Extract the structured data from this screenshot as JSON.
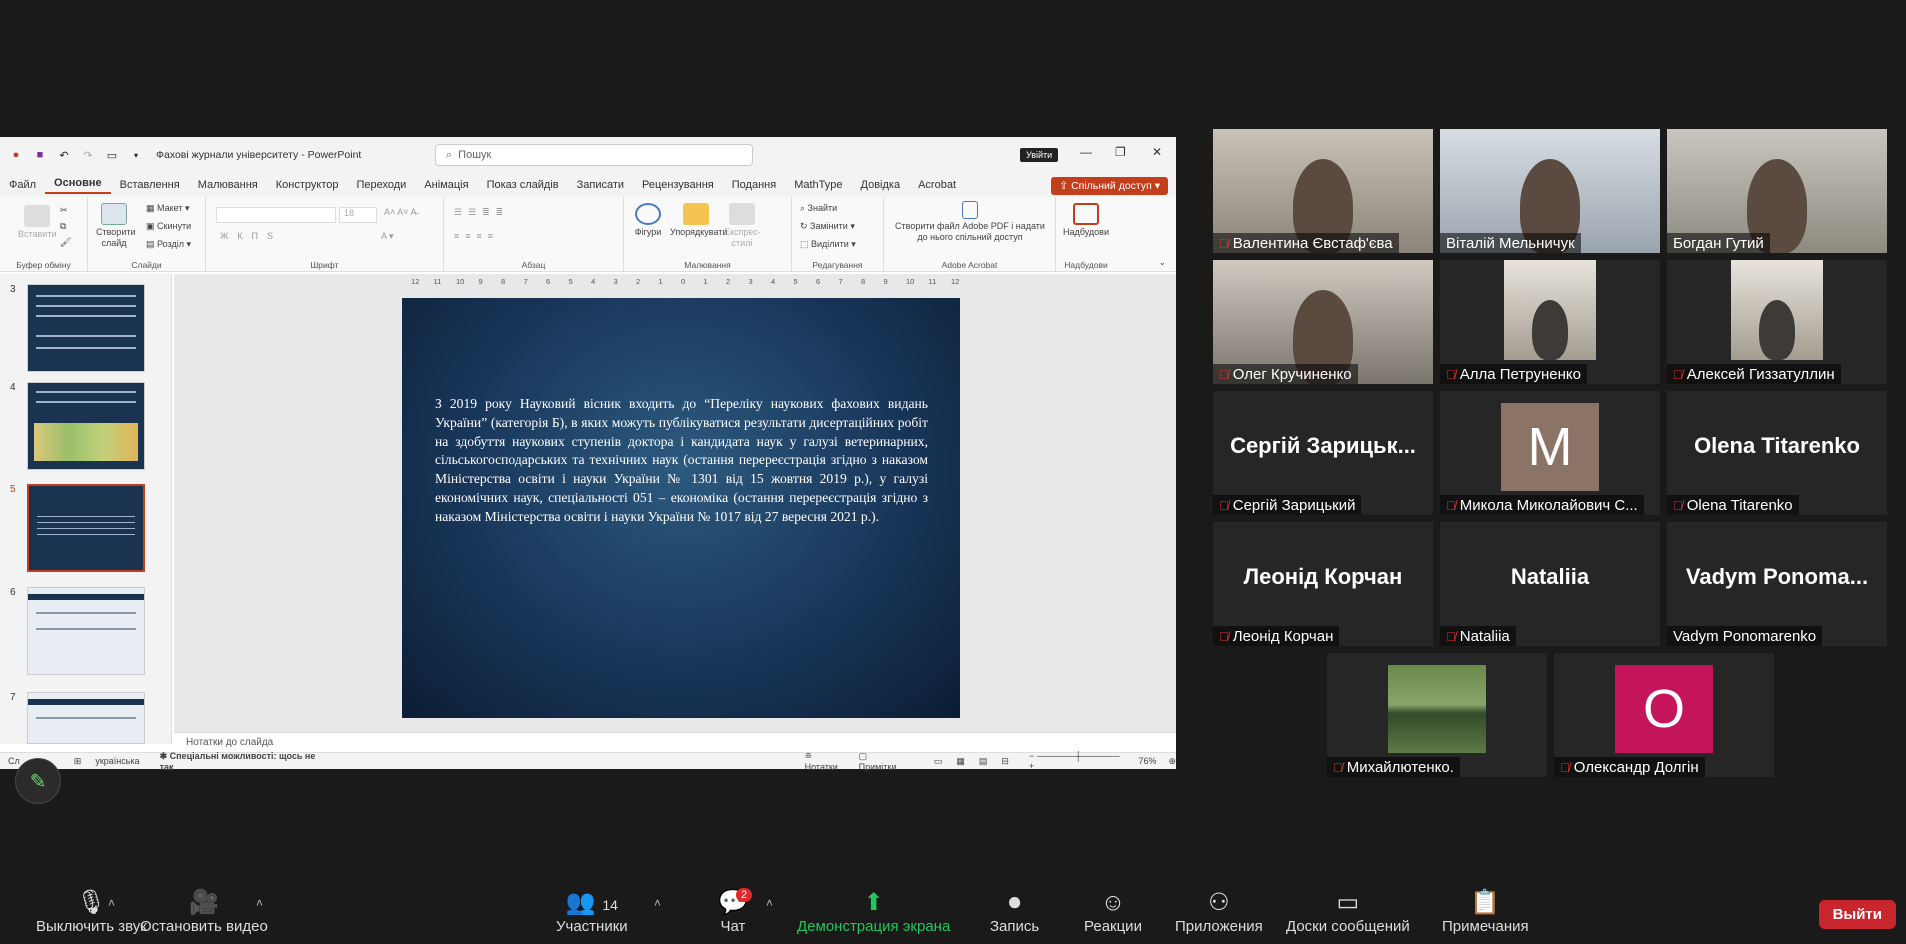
{
  "ppt": {
    "title": "Фахові журнали університету",
    "app": "PowerPoint",
    "search_placeholder": "Пошук",
    "signin": "Увійти",
    "share": "Спільний доступ",
    "menus": [
      "Файл",
      "Основне",
      "Вставлення",
      "Малювання",
      "Конструктор",
      "Переходи",
      "Анімація",
      "Показ слайдів",
      "Записати",
      "Рецензування",
      "Подання",
      "MathType",
      "Довідка",
      "Acrobat"
    ],
    "ribbon": {
      "paste": "Вставити",
      "clipboard": "Буфер обміну",
      "new_slide": "Створити слайд",
      "layout": "Макет",
      "reset": "Скинути",
      "section": "Розділ",
      "slides": "Слайди",
      "font": "Шрифт",
      "paragraph": "Абзац",
      "shapes": "Фігури",
      "arrange": "Упорядкувати",
      "quick_styles": "Експрес-стилі",
      "drawing": "Малювання",
      "find": "Знайти",
      "replace": "Замінити",
      "select": "Виділити",
      "editing": "Редагування",
      "acrobat_btn": "Створити файл Adobe PDF і надати до нього спільний доступ",
      "acrobat": "Adobe Acrobat",
      "addins_btn": "Надбудови",
      "addins": "Надбудови",
      "font_size": "18"
    },
    "thumb_numbers": [
      "3",
      "4",
      "5",
      "6",
      "7"
    ],
    "slide_text": "З 2019 року Науковий вісник входить до “Переліку наукових фахових видань України” (категорія Б), в яких можуть публікуватися результати дисертаційних робіт на здобуття наукових ступенів доктора і кандидата наук у галузі ветеринарних, сільськогосподарських та технічних наук (остання перереєстрація згідно з наказом Міністерства освіти і науки України № 1301 від 15 жовтня 2019 р.), у галузі економічних наук, спеціальності 051 – економіка (остання перереєстрація згідно з наказом Міністерства освіти і науки України № 1017 від 27 вересня 2021 р.).",
    "notes": "Нотатки до слайда",
    "status": {
      "lang": "українська",
      "access": "Спеціальні можливості: щось не так",
      "notes_btn": "Нотатки",
      "comments_btn": "Примітки",
      "zoom": "76%",
      "slide_prefix": "Сл"
    }
  },
  "participants": [
    {
      "name": "Валентина Євстаф'єва",
      "type": "video",
      "muted": true
    },
    {
      "name": "Віталій Мельничук",
      "type": "video",
      "muted": false
    },
    {
      "name": "Богдан Гутий",
      "type": "video",
      "muted": false,
      "speaking": true
    },
    {
      "name": "Олег Кручиненко",
      "type": "video",
      "muted": true
    },
    {
      "name": "Алла Петруненко",
      "type": "video",
      "muted": true
    },
    {
      "name": "Алексей Гиззатуллин",
      "type": "video",
      "muted": true
    },
    {
      "name": "Сергій Зарицький",
      "big": "Сергій Зарицьк...",
      "type": "text",
      "muted": true
    },
    {
      "name": "Микола Миколайович С...",
      "type": "avatar",
      "letter": "M",
      "color": "#8b7366",
      "muted": true
    },
    {
      "name": "Olena Titarenko",
      "big": "Olena Titarenko",
      "type": "text",
      "muted": true
    },
    {
      "name": "Леонід Корчан",
      "big": "Леонід Корчан",
      "type": "text",
      "muted": true
    },
    {
      "name": "Nataliia",
      "big": "Nataliia",
      "type": "text",
      "muted": true
    },
    {
      "name": "Vadym Ponomarenko",
      "big": "Vadym  Ponoma...",
      "type": "text",
      "muted": false
    },
    {
      "name": "Михайлютенко.",
      "type": "photo",
      "muted": true
    },
    {
      "name": "Олександр Долгін",
      "type": "avatar",
      "letter": "O",
      "color": "#c4145a",
      "muted": true
    }
  ],
  "toolbar": {
    "mute": "Выключить звук",
    "video": "Остановить видео",
    "participants": "Участники",
    "participants_count": "14",
    "chat": "Чат",
    "chat_badge": "2",
    "share": "Демонстрация экрана",
    "record": "Запись",
    "reactions": "Реакции",
    "apps": "Приложения",
    "whiteboards": "Доски сообщений",
    "notes": "Примечания",
    "leave": "Выйти"
  }
}
